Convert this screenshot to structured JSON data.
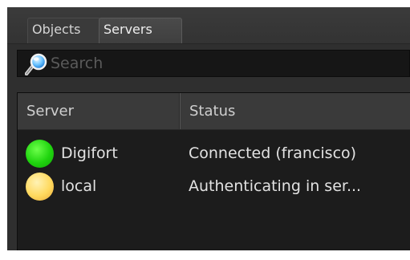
{
  "tabs": [
    {
      "label": "Objects",
      "active": false
    },
    {
      "label": "Servers",
      "active": true
    }
  ],
  "search": {
    "placeholder": "Search",
    "value": "",
    "icon": "magnifier-icon"
  },
  "table": {
    "columns": [
      "Server",
      "Status"
    ],
    "rows": [
      {
        "server": "Digifort",
        "status": "Connected (francisco)",
        "status_icon": "green-status-icon",
        "status_color": "#1fd40e"
      },
      {
        "server": "local",
        "status": "Authenticating in ser...",
        "status_icon": "yellow-status-icon",
        "status_color": "#ffd95e"
      }
    ]
  },
  "colors": {
    "panel_bg": "#2f2f2f",
    "list_bg": "#1c1c1c",
    "header_bg": "#3a3a3a",
    "text": "#e2e2e2"
  }
}
